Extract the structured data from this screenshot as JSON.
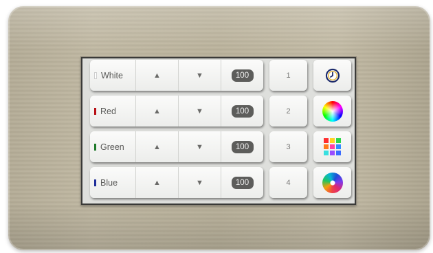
{
  "channels": [
    {
      "name": "White",
      "color": "#ffffff",
      "up": "▲",
      "down": "▼",
      "value": "100"
    },
    {
      "name": "Red",
      "color": "#b80f15",
      "up": "▲",
      "down": "▼",
      "value": "100"
    },
    {
      "name": "Green",
      "color": "#1f7a2a",
      "up": "▲",
      "down": "▼",
      "value": "100"
    },
    {
      "name": "Blue",
      "color": "#1f2f9a",
      "up": "▲",
      "down": "▼",
      "value": "100"
    }
  ],
  "presets": [
    "1",
    "2",
    "3",
    "4"
  ],
  "modes": [
    {
      "icon": "clock-icon"
    },
    {
      "icon": "color-wheel-icon"
    },
    {
      "icon": "color-grid-icon",
      "colors": [
        "#ff2d2d",
        "#ffd21f",
        "#2bd64a",
        "#ff7a1a",
        "#ff3fa6",
        "#2f8cff",
        "#38e0e0",
        "#9a4dff",
        "#3a6cff"
      ]
    },
    {
      "icon": "color-swirl-icon"
    }
  ]
}
